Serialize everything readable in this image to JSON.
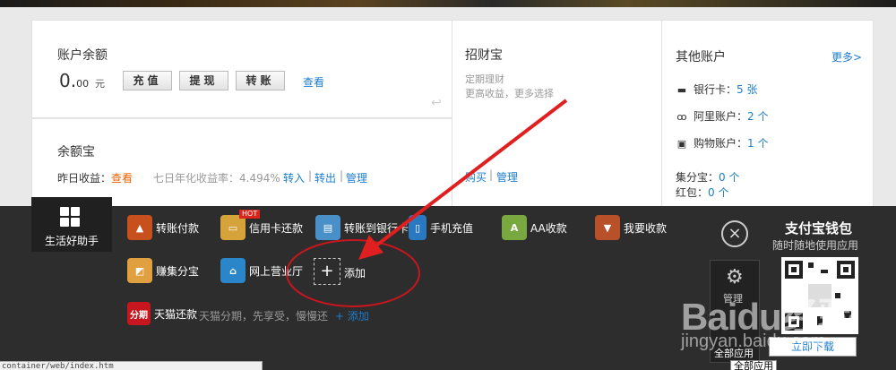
{
  "balance": {
    "title": "账户余额",
    "amount_int": "0.",
    "amount_dec": "00",
    "unit": "元",
    "buttons": [
      "充值",
      "提现",
      "转账"
    ],
    "view_link": "查看"
  },
  "yuebao": {
    "title": "余额宝",
    "yesterday_label": "昨日收益：",
    "yesterday_link": "查看",
    "rate_text": "七日年化收益率：4.494%",
    "actions": [
      "转入",
      "转出",
      "管理"
    ]
  },
  "zhaocaibao": {
    "title": "招财宝",
    "line1": "定期理财",
    "line2": "更高收益，更多选择",
    "actions": [
      "购买",
      "管理"
    ]
  },
  "other_accounts": {
    "title": "其他账户",
    "more": "更多>",
    "bank_label": "银行卡：",
    "bank_value": "5 张",
    "ali_label": "阿里账户：",
    "ali_value": "2 个",
    "shop_label": "购物账户：",
    "shop_value": "1 个",
    "jifen_label": "集分宝：",
    "jifen_value": "0 个",
    "hongbao_label": "红包：",
    "hongbao_value": "0 个"
  },
  "toolbar": {
    "home_label": "生活好助手",
    "apps": [
      {
        "label": "转账付款",
        "color": "#c8501c"
      },
      {
        "label": "信用卡还款",
        "color": "#d6a23a"
      },
      {
        "label": "转账到银行卡",
        "color": "#4a90c8"
      },
      {
        "label": "手机充值",
        "color": "#2a78c0"
      },
      {
        "label": "AA收款",
        "color": "#7aa840"
      },
      {
        "label": "我要收款",
        "color": "#b8502a"
      },
      {
        "label": "赚集分宝",
        "color": "#e0a040"
      },
      {
        "label": "网上营业厅",
        "color": "#2a86c8"
      }
    ],
    "hot_badge": "HOT",
    "add_label": "添加",
    "tmall_icon_text": "分期",
    "tmall_label": "天猫还款",
    "tmall_desc": "天猫分期，先享受，慢慢还",
    "tmall_add": "+ 添加",
    "wallet_title": "支付宝钱包",
    "wallet_sub": "随时随地使用应用",
    "download": "立即下载",
    "manage": "管理",
    "all_apps": "全部应用",
    "tooltip": "全部应用",
    "close": "×"
  },
  "status_url": "container/web/index.htm",
  "watermark": "Baidu经验",
  "watermark_url": "jingyan.baidu.com"
}
